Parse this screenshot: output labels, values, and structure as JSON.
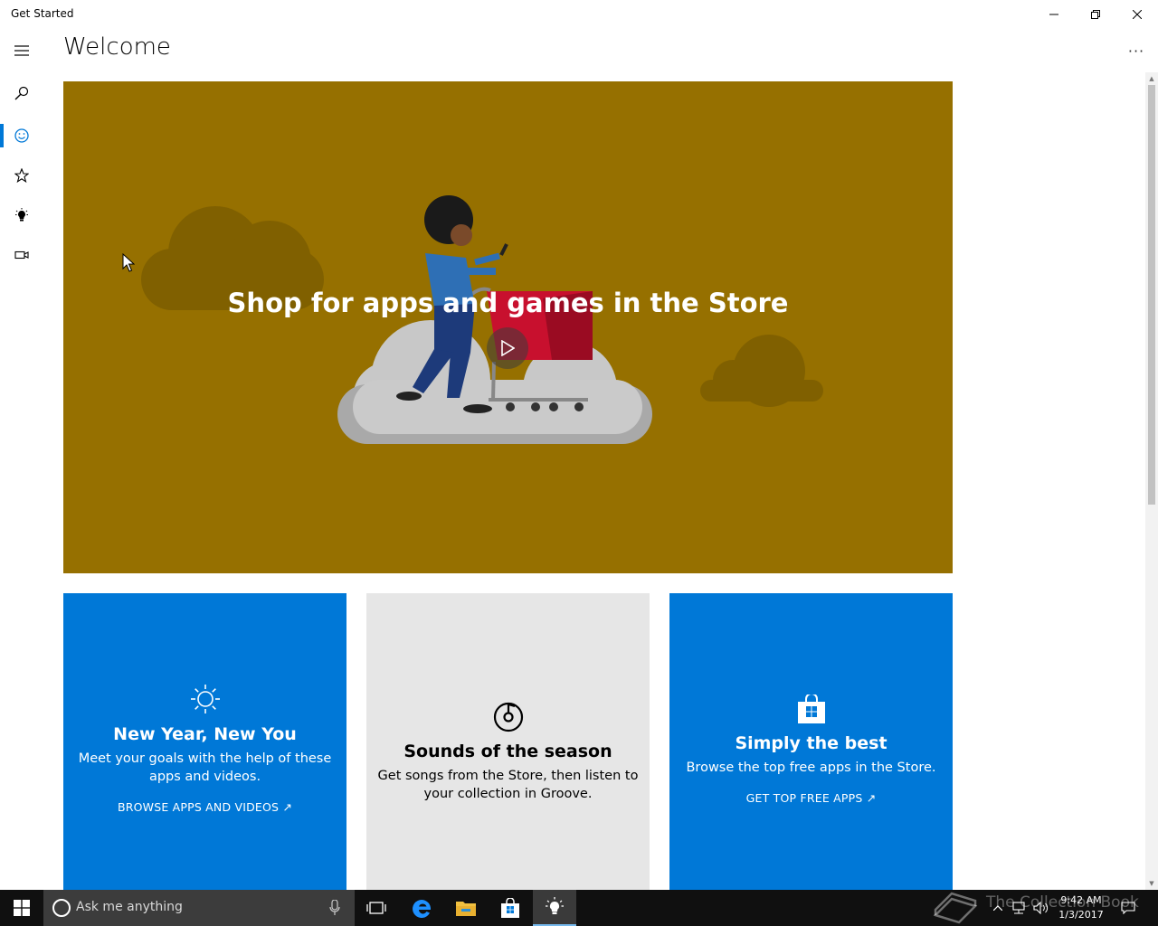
{
  "window": {
    "title": "Get Started"
  },
  "header": {
    "title": "Welcome",
    "more_label": "···"
  },
  "nav": {
    "items": [
      {
        "name": "menu",
        "icon": "hamburger-icon"
      },
      {
        "name": "search",
        "icon": "search-icon"
      },
      {
        "name": "welcome",
        "icon": "smiley-icon",
        "active": true
      },
      {
        "name": "favorites",
        "icon": "star-icon"
      },
      {
        "name": "tips",
        "icon": "lightbulb-icon"
      },
      {
        "name": "videos",
        "icon": "video-camera-icon"
      }
    ]
  },
  "hero": {
    "title": "Shop for apps and games in the Store",
    "background": "#967000"
  },
  "tiles": [
    {
      "title": "New Year, New You",
      "description": "Meet your goals with the help of these apps and videos.",
      "link": "BROWSE APPS AND VIDEOS ↗",
      "icon": "sun-icon",
      "color": "#0078d7"
    },
    {
      "title": "Sounds of the season",
      "description": "Get songs from the Store, then listen to your collection in Groove.",
      "link": "",
      "icon": "groove-music-icon",
      "color": "#e6e6e6"
    },
    {
      "title": "Simply the best",
      "description": "Browse the top free apps in the Store.",
      "link": "GET TOP FREE APPS ↗",
      "icon": "store-bag-icon",
      "color": "#0078d7"
    }
  ],
  "taskbar": {
    "search_placeholder": "Ask me anything",
    "time": "9:42 AM",
    "date": "1/3/2017",
    "watermark": "The Collection Book"
  }
}
